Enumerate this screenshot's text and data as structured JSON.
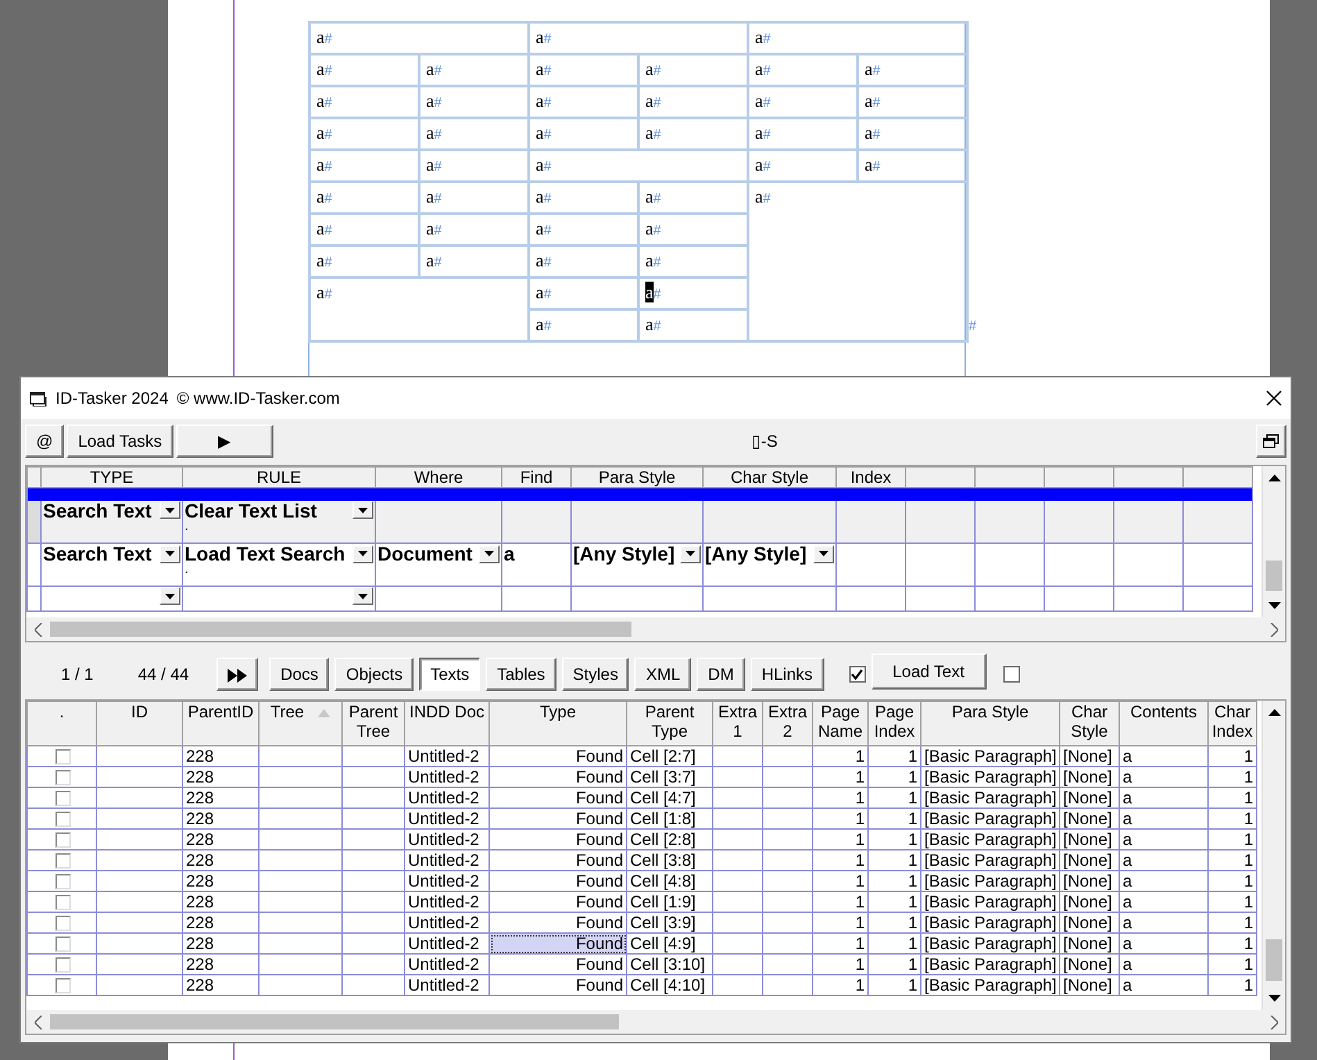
{
  "document_table": {
    "rows": [
      [
        {
          "text": "a",
          "mark": "#",
          "colspan": 2,
          "selected": false
        },
        {
          "text": "a",
          "mark": "#",
          "colspan": 2,
          "selected": false
        },
        {
          "text": "a",
          "mark": "#",
          "colspan": 2,
          "selected": false
        }
      ],
      [
        {
          "text": "a",
          "mark": "#",
          "selected": false
        },
        {
          "text": "a",
          "mark": "#",
          "selected": false
        },
        {
          "text": "a",
          "mark": "#",
          "selected": false
        },
        {
          "text": "a",
          "mark": "#",
          "selected": false
        },
        {
          "text": "a",
          "mark": "#",
          "selected": false
        },
        {
          "text": "a",
          "mark": "#",
          "selected": false
        }
      ],
      [
        {
          "text": "a",
          "mark": "#",
          "selected": false
        },
        {
          "text": "a",
          "mark": "#",
          "selected": false
        },
        {
          "text": "a",
          "mark": "#",
          "selected": false
        },
        {
          "text": "a",
          "mark": "#",
          "selected": false
        },
        {
          "text": "a",
          "mark": "#",
          "selected": false
        },
        {
          "text": "a",
          "mark": "#",
          "selected": false
        }
      ],
      [
        {
          "text": "a",
          "mark": "#",
          "selected": false
        },
        {
          "text": "a",
          "mark": "#",
          "selected": false
        },
        {
          "text": "a",
          "mark": "#",
          "selected": false
        },
        {
          "text": "a",
          "mark": "#",
          "selected": false
        },
        {
          "text": "a",
          "mark": "#",
          "selected": false
        },
        {
          "text": "a",
          "mark": "#",
          "selected": false
        }
      ],
      [
        {
          "text": "a",
          "mark": "#",
          "selected": false
        },
        {
          "text": "a",
          "mark": "#",
          "selected": false
        },
        {
          "text": "a",
          "mark": "#",
          "colspan": 2,
          "selected": false
        },
        {
          "text": "a",
          "mark": "#",
          "selected": false
        },
        {
          "text": "a",
          "mark": "#",
          "selected": false
        }
      ],
      [
        {
          "text": "a",
          "mark": "#",
          "selected": false
        },
        {
          "text": "a",
          "mark": "#",
          "selected": false
        },
        {
          "text": "a",
          "mark": "#",
          "selected": false
        },
        {
          "text": "a",
          "mark": "#",
          "selected": false
        },
        {
          "text": "a",
          "mark": "#",
          "colspan": 2,
          "rowspan": 5,
          "selected": false
        }
      ],
      [
        {
          "text": "a",
          "mark": "#",
          "selected": false
        },
        {
          "text": "a",
          "mark": "#",
          "selected": false
        },
        {
          "text": "a",
          "mark": "#",
          "selected": false
        },
        {
          "text": "a",
          "mark": "#",
          "selected": false
        }
      ],
      [
        {
          "text": "a",
          "mark": "#",
          "selected": false
        },
        {
          "text": "a",
          "mark": "#",
          "selected": false
        },
        {
          "text": "a",
          "mark": "#",
          "selected": false
        },
        {
          "text": "a",
          "mark": "#",
          "selected": false
        }
      ],
      [
        {
          "text": "a",
          "mark": "#",
          "colspan": 2,
          "rowspan": 2,
          "selected": false
        },
        {
          "text": "a",
          "mark": "#",
          "selected": false
        },
        {
          "text": "a",
          "mark": "#",
          "selected": true
        }
      ],
      [
        {
          "text": "a",
          "mark": "#",
          "selected": false
        },
        {
          "text": "a",
          "mark": "#",
          "selected": false
        }
      ]
    ],
    "end_mark": "#"
  },
  "window": {
    "title": "ID-Tasker 2024",
    "subtitle": "© www.ID-Tasker.com"
  },
  "toolbar": {
    "buttons": [
      "@",
      "Load Tasks",
      "▶"
    ],
    "caption": "▯-S"
  },
  "rules": {
    "columns": [
      "TYPE",
      "RULE",
      "Where",
      "Find",
      "Para Style",
      "Char Style",
      "Index"
    ],
    "rows": [
      {
        "kind": "group"
      },
      {
        "kind": "rule",
        "selected": true,
        "note": ".",
        "cells": [
          {
            "text": "Search Text",
            "dropdown": true
          },
          {
            "text": "Clear Text List",
            "dropdown": true
          },
          {
            "dropdown": false
          },
          {
            "dropdown": false
          },
          {
            "dropdown": false
          },
          {
            "dropdown": false
          },
          {
            "dropdown": false
          }
        ]
      },
      {
        "kind": "rule",
        "selected": false,
        "note": ".",
        "cells": [
          {
            "text": "Search Text",
            "dropdown": true
          },
          {
            "text": "Load Text Search",
            "dropdown": true
          },
          {
            "text": "Document",
            "dropdown": true
          },
          {
            "text": "a",
            "dropdown": false
          },
          {
            "text": "[Any Style]",
            "dropdown": true
          },
          {
            "text": "[Any Style]",
            "dropdown": true
          },
          {
            "dropdown": false
          }
        ]
      },
      {
        "kind": "rule",
        "selected": false,
        "cells": [
          {
            "dropdown": true
          },
          {
            "dropdown": true
          },
          {
            "dropdown": false
          },
          {
            "dropdown": false
          },
          {
            "dropdown": false
          },
          {
            "dropdown": false
          },
          {
            "dropdown": false
          }
        ]
      }
    ]
  },
  "navigator": {
    "page": "1 / 1",
    "count": "44 / 44",
    "tabs": [
      {
        "label": "Docs",
        "selected": false
      },
      {
        "label": "Objects",
        "selected": false
      },
      {
        "label": "Texts",
        "selected": true
      },
      {
        "label": "Tables",
        "selected": false
      },
      {
        "label": "Styles",
        "selected": false
      },
      {
        "label": "XML",
        "selected": false
      },
      {
        "label": "DM",
        "selected": false
      },
      {
        "label": "HLinks",
        "selected": false
      }
    ],
    "option_1": {
      "checked": true
    },
    "load_button": "Load Text",
    "option_2": {
      "checked": false
    }
  },
  "results": {
    "columns": [
      {
        "label": ".",
        "sorted": false
      },
      {
        "label": "ID",
        "sorted": false
      },
      {
        "label": "ParentID",
        "sorted": false
      },
      {
        "label": "Tree",
        "sorted": true
      },
      {
        "label": "Parent Tree",
        "sorted": false
      },
      {
        "label": "INDD Doc",
        "sorted": false
      },
      {
        "label": "Type",
        "sorted": false
      },
      {
        "label": "Parent Type",
        "sorted": false
      },
      {
        "label": "Extra 1",
        "sorted": false
      },
      {
        "label": "Extra 2",
        "sorted": false
      },
      {
        "label": "Page Name",
        "sorted": false
      },
      {
        "label": "Page Index",
        "sorted": false
      },
      {
        "label": "Para Style",
        "sorted": false
      },
      {
        "label": "Char Style",
        "sorted": false
      },
      {
        "label": "Contents",
        "sorted": false
      },
      {
        "label": "Char Index",
        "sorted": false
      }
    ],
    "rows": [
      {
        "checked": false,
        "focused": false,
        "parent_id": "228",
        "indd_doc": "Untitled-2",
        "type": "Found",
        "parent_type": "Cell [2:7]",
        "page_name": "1",
        "page_index": "1",
        "para_style": "[Basic Paragraph]",
        "char_style": "[None]",
        "contents": "a",
        "char_index": "1"
      },
      {
        "checked": false,
        "focused": false,
        "parent_id": "228",
        "indd_doc": "Untitled-2",
        "type": "Found",
        "parent_type": "Cell [3:7]",
        "page_name": "1",
        "page_index": "1",
        "para_style": "[Basic Paragraph]",
        "char_style": "[None]",
        "contents": "a",
        "char_index": "1"
      },
      {
        "checked": false,
        "focused": false,
        "parent_id": "228",
        "indd_doc": "Untitled-2",
        "type": "Found",
        "parent_type": "Cell [4:7]",
        "page_name": "1",
        "page_index": "1",
        "para_style": "[Basic Paragraph]",
        "char_style": "[None]",
        "contents": "a",
        "char_index": "1"
      },
      {
        "checked": false,
        "focused": false,
        "parent_id": "228",
        "indd_doc": "Untitled-2",
        "type": "Found",
        "parent_type": "Cell [1:8]",
        "page_name": "1",
        "page_index": "1",
        "para_style": "[Basic Paragraph]",
        "char_style": "[None]",
        "contents": "a",
        "char_index": "1"
      },
      {
        "checked": false,
        "focused": false,
        "parent_id": "228",
        "indd_doc": "Untitled-2",
        "type": "Found",
        "parent_type": "Cell [2:8]",
        "page_name": "1",
        "page_index": "1",
        "para_style": "[Basic Paragraph]",
        "char_style": "[None]",
        "contents": "a",
        "char_index": "1"
      },
      {
        "checked": false,
        "focused": false,
        "parent_id": "228",
        "indd_doc": "Untitled-2",
        "type": "Found",
        "parent_type": "Cell [3:8]",
        "page_name": "1",
        "page_index": "1",
        "para_style": "[Basic Paragraph]",
        "char_style": "[None]",
        "contents": "a",
        "char_index": "1"
      },
      {
        "checked": false,
        "focused": false,
        "parent_id": "228",
        "indd_doc": "Untitled-2",
        "type": "Found",
        "parent_type": "Cell [4:8]",
        "page_name": "1",
        "page_index": "1",
        "para_style": "[Basic Paragraph]",
        "char_style": "[None]",
        "contents": "a",
        "char_index": "1"
      },
      {
        "checked": false,
        "focused": false,
        "parent_id": "228",
        "indd_doc": "Untitled-2",
        "type": "Found",
        "parent_type": "Cell [1:9]",
        "page_name": "1",
        "page_index": "1",
        "para_style": "[Basic Paragraph]",
        "char_style": "[None]",
        "contents": "a",
        "char_index": "1"
      },
      {
        "checked": false,
        "focused": false,
        "parent_id": "228",
        "indd_doc": "Untitled-2",
        "type": "Found",
        "parent_type": "Cell [3:9]",
        "page_name": "1",
        "page_index": "1",
        "para_style": "[Basic Paragraph]",
        "char_style": "[None]",
        "contents": "a",
        "char_index": "1"
      },
      {
        "checked": false,
        "focused": true,
        "parent_id": "228",
        "indd_doc": "Untitled-2",
        "type": "Found",
        "parent_type": "Cell [4:9]",
        "page_name": "1",
        "page_index": "1",
        "para_style": "[Basic Paragraph]",
        "char_style": "[None]",
        "contents": "a",
        "char_index": "1"
      },
      {
        "checked": false,
        "focused": false,
        "parent_id": "228",
        "indd_doc": "Untitled-2",
        "type": "Found",
        "parent_type": "Cell [3:10]",
        "page_name": "1",
        "page_index": "1",
        "para_style": "[Basic Paragraph]",
        "char_style": "[None]",
        "contents": "a",
        "char_index": "1"
      },
      {
        "checked": false,
        "focused": false,
        "parent_id": "228",
        "indd_doc": "Untitled-2",
        "type": "Found",
        "parent_type": "Cell [4:10]",
        "page_name": "1",
        "page_index": "1",
        "para_style": "[Basic Paragraph]",
        "char_style": "[None]",
        "contents": "a",
        "char_index": "1"
      }
    ]
  }
}
